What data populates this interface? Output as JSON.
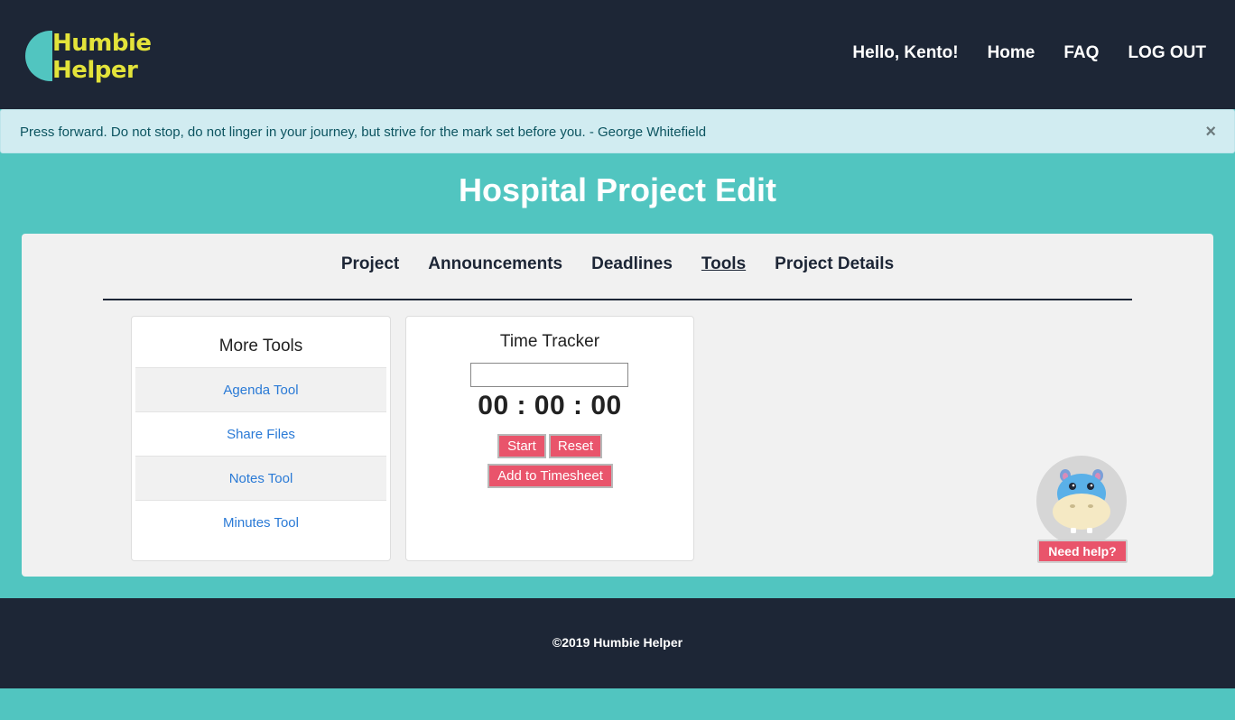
{
  "header": {
    "logo": {
      "line1": "Humbie",
      "line2": "Helper"
    },
    "nav": [
      {
        "label": "Hello, Kento!"
      },
      {
        "label": "Home"
      },
      {
        "label": "FAQ"
      },
      {
        "label": "LOG OUT"
      }
    ]
  },
  "alert": {
    "text": "Press forward. Do not stop, do not linger in your journey, but strive for the mark set before you. - George Whitefield",
    "close": "×"
  },
  "page": {
    "title": "Hospital Project Edit"
  },
  "tabs": [
    {
      "label": "Project"
    },
    {
      "label": "Announcements"
    },
    {
      "label": "Deadlines"
    },
    {
      "label": "Tools",
      "active": true
    },
    {
      "label": "Project Details"
    }
  ],
  "more_tools": {
    "title": "More Tools",
    "items": [
      {
        "label": "Agenda Tool"
      },
      {
        "label": "Share Files"
      },
      {
        "label": "Notes Tool"
      },
      {
        "label": "Minutes Tool"
      }
    ]
  },
  "time_tracker": {
    "title": "Time Tracker",
    "input_value": "",
    "timer": "00 : 00 : 00",
    "start_label": "Start",
    "reset_label": "Reset",
    "add_label": "Add to Timesheet"
  },
  "helper": {
    "label": "Need help?",
    "icon": "hippo-mascot-icon"
  },
  "footer": {
    "text": "©2019 Humbie Helper"
  },
  "colors": {
    "dark": "#1d2636",
    "teal": "#51c5c0",
    "logo_yellow": "#e3e33a",
    "button_red": "#e9546b",
    "link_blue": "#2a7ad6",
    "alert_bg": "#d1ecf1"
  }
}
